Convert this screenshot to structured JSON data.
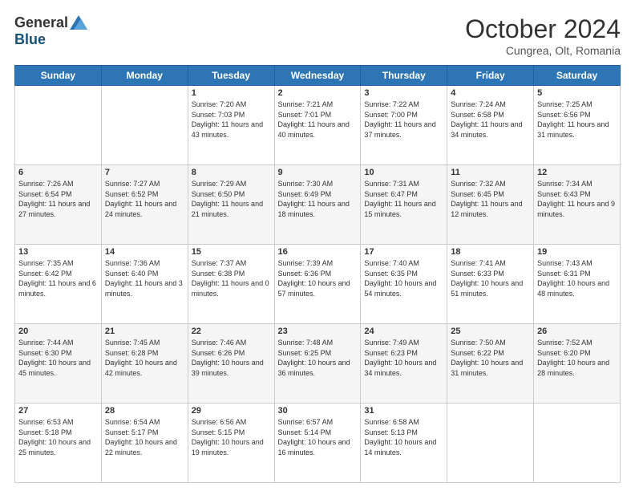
{
  "header": {
    "logo_general": "General",
    "logo_blue": "Blue",
    "month_title": "October 2024",
    "subtitle": "Cungrea, Olt, Romania"
  },
  "weekdays": [
    "Sunday",
    "Monday",
    "Tuesday",
    "Wednesday",
    "Thursday",
    "Friday",
    "Saturday"
  ],
  "weeks": [
    [
      {
        "day": "",
        "content": ""
      },
      {
        "day": "",
        "content": ""
      },
      {
        "day": "1",
        "content": "Sunrise: 7:20 AM\nSunset: 7:03 PM\nDaylight: 11 hours and 43 minutes."
      },
      {
        "day": "2",
        "content": "Sunrise: 7:21 AM\nSunset: 7:01 PM\nDaylight: 11 hours and 40 minutes."
      },
      {
        "day": "3",
        "content": "Sunrise: 7:22 AM\nSunset: 7:00 PM\nDaylight: 11 hours and 37 minutes."
      },
      {
        "day": "4",
        "content": "Sunrise: 7:24 AM\nSunset: 6:58 PM\nDaylight: 11 hours and 34 minutes."
      },
      {
        "day": "5",
        "content": "Sunrise: 7:25 AM\nSunset: 6:56 PM\nDaylight: 11 hours and 31 minutes."
      }
    ],
    [
      {
        "day": "6",
        "content": "Sunrise: 7:26 AM\nSunset: 6:54 PM\nDaylight: 11 hours and 27 minutes."
      },
      {
        "day": "7",
        "content": "Sunrise: 7:27 AM\nSunset: 6:52 PM\nDaylight: 11 hours and 24 minutes."
      },
      {
        "day": "8",
        "content": "Sunrise: 7:29 AM\nSunset: 6:50 PM\nDaylight: 11 hours and 21 minutes."
      },
      {
        "day": "9",
        "content": "Sunrise: 7:30 AM\nSunset: 6:49 PM\nDaylight: 11 hours and 18 minutes."
      },
      {
        "day": "10",
        "content": "Sunrise: 7:31 AM\nSunset: 6:47 PM\nDaylight: 11 hours and 15 minutes."
      },
      {
        "day": "11",
        "content": "Sunrise: 7:32 AM\nSunset: 6:45 PM\nDaylight: 11 hours and 12 minutes."
      },
      {
        "day": "12",
        "content": "Sunrise: 7:34 AM\nSunset: 6:43 PM\nDaylight: 11 hours and 9 minutes."
      }
    ],
    [
      {
        "day": "13",
        "content": "Sunrise: 7:35 AM\nSunset: 6:42 PM\nDaylight: 11 hours and 6 minutes."
      },
      {
        "day": "14",
        "content": "Sunrise: 7:36 AM\nSunset: 6:40 PM\nDaylight: 11 hours and 3 minutes."
      },
      {
        "day": "15",
        "content": "Sunrise: 7:37 AM\nSunset: 6:38 PM\nDaylight: 11 hours and 0 minutes."
      },
      {
        "day": "16",
        "content": "Sunrise: 7:39 AM\nSunset: 6:36 PM\nDaylight: 10 hours and 57 minutes."
      },
      {
        "day": "17",
        "content": "Sunrise: 7:40 AM\nSunset: 6:35 PM\nDaylight: 10 hours and 54 minutes."
      },
      {
        "day": "18",
        "content": "Sunrise: 7:41 AM\nSunset: 6:33 PM\nDaylight: 10 hours and 51 minutes."
      },
      {
        "day": "19",
        "content": "Sunrise: 7:43 AM\nSunset: 6:31 PM\nDaylight: 10 hours and 48 minutes."
      }
    ],
    [
      {
        "day": "20",
        "content": "Sunrise: 7:44 AM\nSunset: 6:30 PM\nDaylight: 10 hours and 45 minutes."
      },
      {
        "day": "21",
        "content": "Sunrise: 7:45 AM\nSunset: 6:28 PM\nDaylight: 10 hours and 42 minutes."
      },
      {
        "day": "22",
        "content": "Sunrise: 7:46 AM\nSunset: 6:26 PM\nDaylight: 10 hours and 39 minutes."
      },
      {
        "day": "23",
        "content": "Sunrise: 7:48 AM\nSunset: 6:25 PM\nDaylight: 10 hours and 36 minutes."
      },
      {
        "day": "24",
        "content": "Sunrise: 7:49 AM\nSunset: 6:23 PM\nDaylight: 10 hours and 34 minutes."
      },
      {
        "day": "25",
        "content": "Sunrise: 7:50 AM\nSunset: 6:22 PM\nDaylight: 10 hours and 31 minutes."
      },
      {
        "day": "26",
        "content": "Sunrise: 7:52 AM\nSunset: 6:20 PM\nDaylight: 10 hours and 28 minutes."
      }
    ],
    [
      {
        "day": "27",
        "content": "Sunrise: 6:53 AM\nSunset: 5:18 PM\nDaylight: 10 hours and 25 minutes."
      },
      {
        "day": "28",
        "content": "Sunrise: 6:54 AM\nSunset: 5:17 PM\nDaylight: 10 hours and 22 minutes."
      },
      {
        "day": "29",
        "content": "Sunrise: 6:56 AM\nSunset: 5:15 PM\nDaylight: 10 hours and 19 minutes."
      },
      {
        "day": "30",
        "content": "Sunrise: 6:57 AM\nSunset: 5:14 PM\nDaylight: 10 hours and 16 minutes."
      },
      {
        "day": "31",
        "content": "Sunrise: 6:58 AM\nSunset: 5:13 PM\nDaylight: 10 hours and 14 minutes."
      },
      {
        "day": "",
        "content": ""
      },
      {
        "day": "",
        "content": ""
      }
    ]
  ]
}
